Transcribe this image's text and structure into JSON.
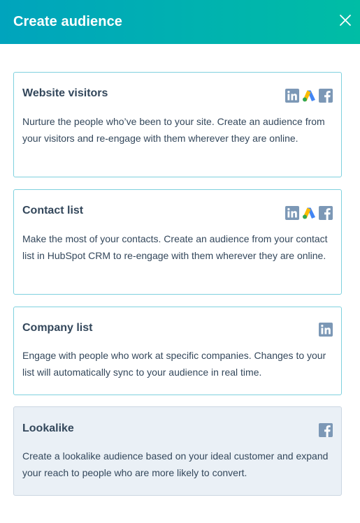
{
  "header": {
    "title": "Create audience"
  },
  "cards": [
    {
      "title": "Website visitors",
      "description": "Nurture the people who’ve been to your site. Create an audience from your visitors and re-engage with them wherever they are online.",
      "icons": [
        "linkedin-icon",
        "google-ads-icon",
        "facebook-icon"
      ]
    },
    {
      "title": "Contact list",
      "description": "Make the most of your contacts. Create an audience from your contact list in HubSpot CRM to re-engage with them wherever they are online.",
      "icons": [
        "linkedin-icon",
        "google-ads-icon",
        "facebook-icon"
      ]
    },
    {
      "title": "Company list",
      "description": "Engage with people who work at specific companies. Changes to your list will automatically sync to your audience in real time.",
      "icons": [
        "linkedin-icon"
      ]
    },
    {
      "title": "Lookalike",
      "description": "Create a lookalike audience based on your ideal customer and expand your reach to people who are more likely to convert.",
      "icons": [
        "facebook-icon"
      ],
      "selected": true
    }
  ],
  "colors": {
    "header_start": "#00a4bd",
    "header_end": "#00bda5",
    "card_border": "#7fd1de",
    "selected_bg": "#eaf0f6",
    "text": "#33475b",
    "icon": "#7c98b6"
  }
}
